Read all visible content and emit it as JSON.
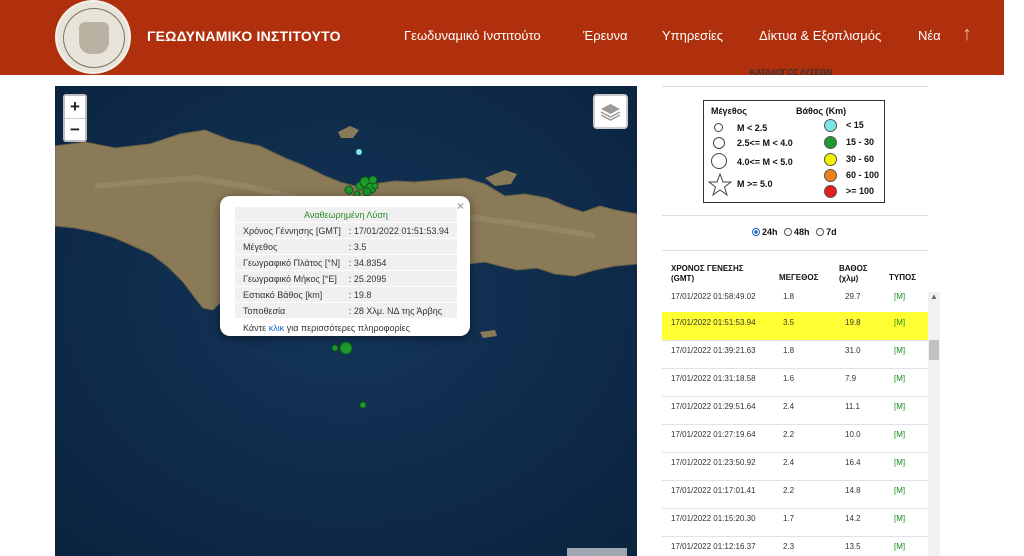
{
  "header": {
    "site_title": "ΓΕΩΔΥΝΑΜΙΚΟ ΙΝΣΤΙΤΟΥΤΟ",
    "nav": [
      "Γεωδυναμικό Ινστιτούτο",
      "Έρευνα",
      "Υπηρεσίες",
      "Δίκτυα & Εξοπλισμός",
      "Νέα"
    ],
    "up_arrow": "↑"
  },
  "map": {
    "zoom_in": "+",
    "zoom_out": "−",
    "popup": {
      "title": "Αναθεωρημένη Λύση",
      "close": "×",
      "rows": [
        {
          "label": "Χρόνος Γέννησης [GMT]",
          "value": ": 17/01/2022 01:51:53.94"
        },
        {
          "label": "Μέγεθος",
          "value": ": 3.5"
        },
        {
          "label": "Γεωγραφικό Πλάτος [°N]",
          "value": ": 34.8354"
        },
        {
          "label": "Γεωγραφικό Μήκος [°E]",
          "value": ": 25.2095"
        },
        {
          "label": "Εστιακό Βάθος [km]",
          "value": ": 19.8"
        },
        {
          "label": "Τοποθεσία",
          "value": ": 28 Χλμ. ΝΔ της Άρβης"
        }
      ],
      "more_prefix": "Κάντε",
      "more_link": "κλικ",
      "more_suffix": "για περισσότερες πληροφορίες"
    }
  },
  "panel": {
    "catalog_title": "ΚΑΤΑΛΟΓΟΣ ΛΥΣΕΩΝ",
    "legend": {
      "magnitude_header": "Μέγεθος",
      "depth_header": "Βάθος (Km)",
      "magnitudes": [
        "M < 2.5",
        "2.5<= M < 4.0",
        "4.0<= M < 5.0",
        "M >= 5.0"
      ],
      "depths": [
        {
          "label": "< 15",
          "color": "#7fe3e6"
        },
        {
          "label": "15 - 30",
          "color": "#1f9a2e"
        },
        {
          "label": "30 - 60",
          "color": "#f2f200"
        },
        {
          "label": "60 - 100",
          "color": "#f07f1d"
        },
        {
          "label": ">= 100",
          "color": "#e0201a"
        }
      ]
    },
    "time_options": [
      "24h",
      "48h",
      "7d"
    ],
    "time_selected": "24h",
    "table": {
      "headers": {
        "time": "ΧΡΟΝΟΣ ΓΕΝΕΣΗΣ",
        "time_unit": "(GMT)",
        "mag": "ΜΕΓΕΘΟΣ",
        "depth": "ΒΑΘΟΣ",
        "depth_unit": "(χλμ)",
        "type": "ΤΥΠΟΣ"
      },
      "rows": [
        {
          "time": "17/01/2022 01:58:49.02",
          "mag": "1.8",
          "depth": "29.7",
          "type": "[M]"
        },
        {
          "time": "17/01/2022 01:51:53.94",
          "mag": "3.5",
          "depth": "19.8",
          "type": "[M]"
        },
        {
          "time": "17/01/2022 01:39:21.63",
          "mag": "1.8",
          "depth": "31.0",
          "type": "[M]"
        },
        {
          "time": "17/01/2022 01:31:18.58",
          "mag": "1.6",
          "depth": "7.9",
          "type": "[M]"
        },
        {
          "time": "17/01/2022 01:29:51.64",
          "mag": "2.4",
          "depth": "11.1",
          "type": "[M]"
        },
        {
          "time": "17/01/2022 01:27:19.64",
          "mag": "2.2",
          "depth": "10.0",
          "type": "[M]"
        },
        {
          "time": "17/01/2022 01:23:50.92",
          "mag": "2.4",
          "depth": "16.4",
          "type": "[M]"
        },
        {
          "time": "17/01/2022 01:17:01.41",
          "mag": "2.2",
          "depth": "14.8",
          "type": "[M]"
        },
        {
          "time": "17/01/2022 01:15:20.30",
          "mag": "1.7",
          "depth": "14.2",
          "type": "[M]"
        },
        {
          "time": "17/01/2022 01:12:16.37",
          "mag": "2.3",
          "depth": "13.5",
          "type": "[M]"
        }
      ],
      "highlight_color": "#ffff33"
    }
  },
  "colors": {
    "header_bg": "#b0300d",
    "sea": "#0e2a47",
    "land": "#8a7a58",
    "quake": "#1f9a2e",
    "quake_shallow": "#7fe3e6"
  }
}
